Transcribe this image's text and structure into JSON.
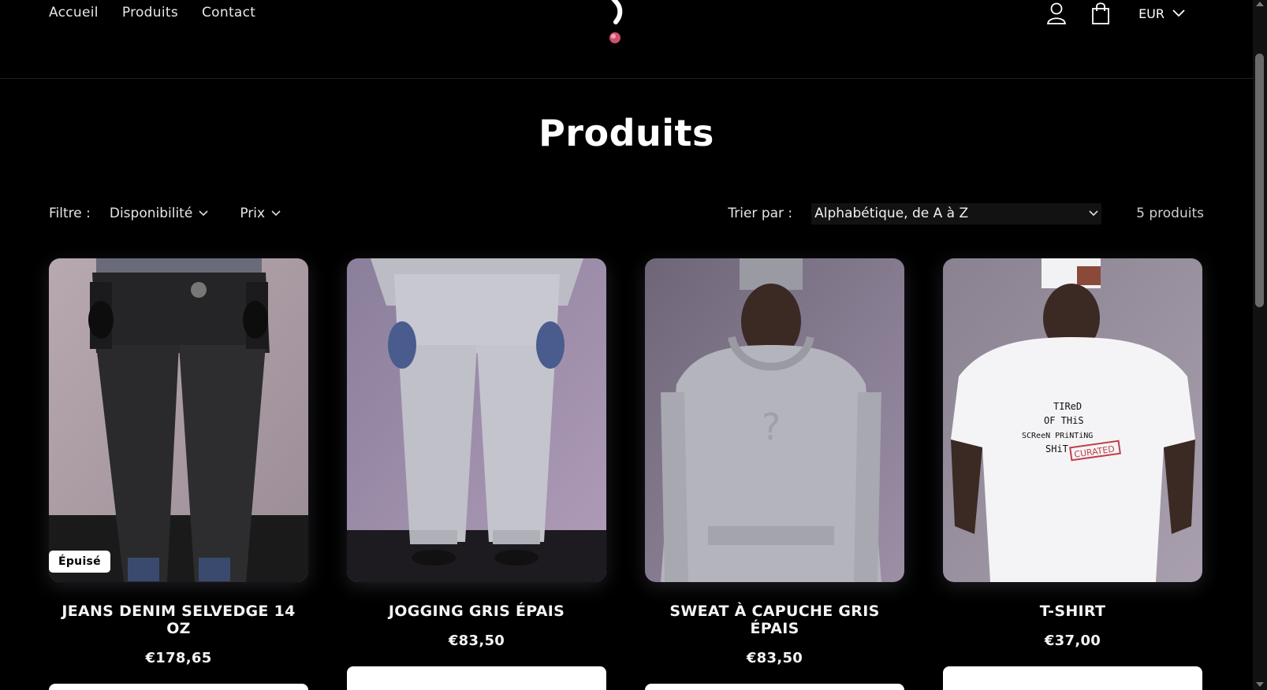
{
  "header": {
    "nav": [
      "Accueil",
      "Produits",
      "Contact"
    ],
    "currency": "EUR",
    "icons": [
      "user-icon",
      "shopping-bag-icon",
      "chevron-down-icon"
    ]
  },
  "page_title": "Produits",
  "filters": {
    "label": "Filtre :",
    "availability": "Disponibilité",
    "price": "Prix",
    "sort_label": "Trier par :",
    "sort_value": "Alphabétique, de A à Z",
    "count": "5 produits"
  },
  "products": [
    {
      "title": "JEANS DENIM SELVEDGE 14 OZ",
      "price": "€178,65",
      "badge": "Épuisé"
    },
    {
      "title": "JOGGING GRIS ÉPAIS",
      "price": "€83,50",
      "badge": ""
    },
    {
      "title": "SWEAT À CAPUCHE GRIS ÉPAIS",
      "price": "€83,50",
      "badge": ""
    },
    {
      "title": "T-SHIRT",
      "price": "€37,00",
      "badge": ""
    }
  ],
  "tshirt_print": [
    "TIReD",
    "OF THiS",
    "SCReeN PRiNTiNG",
    "SHiT",
    "CURATED"
  ],
  "colors": {
    "background": "#000000",
    "text": "#ffffff",
    "accent_logo": "#d0506f"
  }
}
